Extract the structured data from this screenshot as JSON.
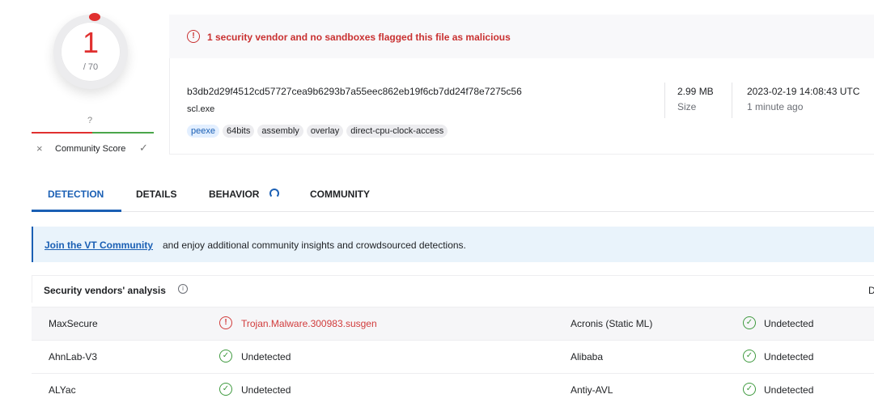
{
  "score": {
    "detections": "1",
    "total": "/ 70"
  },
  "community": {
    "unknown": "?",
    "dislike_icon": "×",
    "label": "Community Score",
    "like_icon": "✓"
  },
  "alert": {
    "icon": "!",
    "text": "1 security vendor and no sandboxes flagged this file as malicious"
  },
  "file": {
    "hash": "b3db2d29f4512cd57727cea9b6293b7a55eec862eb19f6cb7dd24f78e7275c56",
    "name": "scl.exe",
    "tags": [
      "peexe",
      "64bits",
      "assembly",
      "overlay",
      "direct-cpu-clock-access"
    ],
    "size_value": "2.99 MB",
    "size_label": "Size",
    "date_value": "2023-02-19 14:08:43 UTC",
    "date_label": "1 minute ago"
  },
  "tabs": [
    "DETECTION",
    "DETAILS",
    "BEHAVIOR",
    "COMMUNITY"
  ],
  "banner": {
    "link": "Join the VT Community",
    "text": "and enjoy additional community insights and crowdsourced detections."
  },
  "section": {
    "title": "Security vendors' analysis",
    "info_icon": "i",
    "right_partial": "D"
  },
  "rows": [
    {
      "vendor_a": "MaxSecure",
      "icon_a": "!",
      "result_a": "Trojan.Malware.300983.susgen",
      "vendor_b": "Acronis (Static ML)",
      "icon_b": "✓",
      "result_b": "Undetected"
    },
    {
      "vendor_a": "AhnLab-V3",
      "icon_a": "✓",
      "result_a": "Undetected",
      "vendor_b": "Alibaba",
      "icon_b": "✓",
      "result_b": "Undetected"
    },
    {
      "vendor_a": "ALYac",
      "icon_a": "✓",
      "result_a": "Undetected",
      "vendor_b": "Antiy-AVL",
      "icon_b": "✓",
      "result_b": "Undetected"
    }
  ],
  "colors": {
    "malicious": "#e0302f",
    "accent": "#1a5fb4",
    "clean": "#3f9a3f"
  }
}
